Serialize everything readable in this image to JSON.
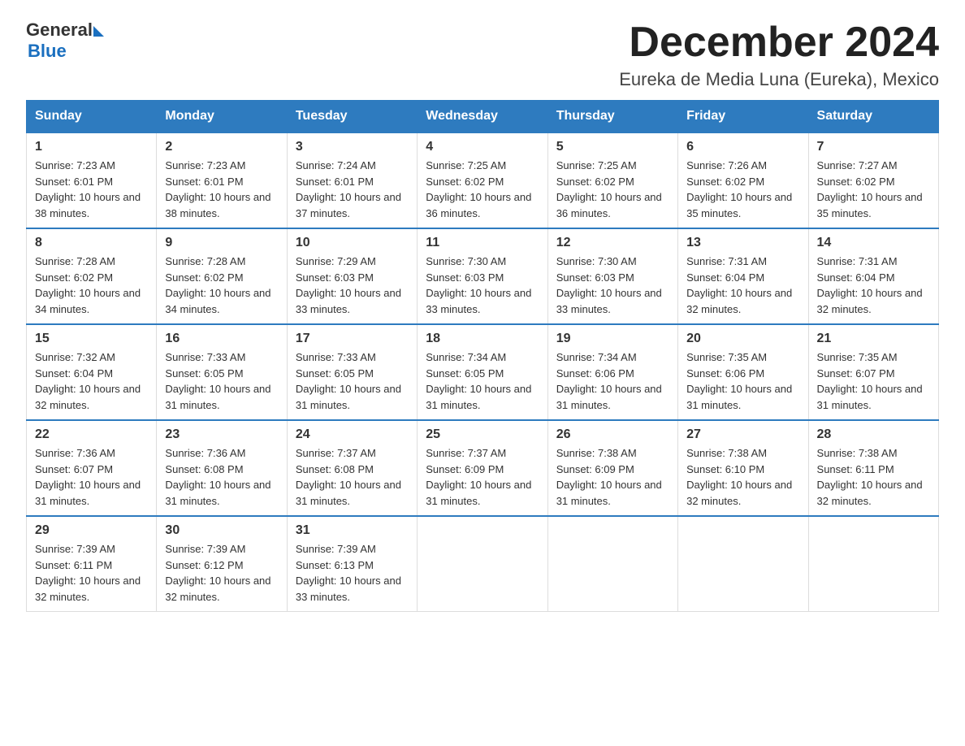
{
  "header": {
    "logo_general": "General",
    "logo_blue": "Blue",
    "title": "December 2024",
    "subtitle": "Eureka de Media Luna (Eureka), Mexico"
  },
  "days_of_week": [
    "Sunday",
    "Monday",
    "Tuesday",
    "Wednesday",
    "Thursday",
    "Friday",
    "Saturday"
  ],
  "weeks": [
    [
      {
        "day": "1",
        "sunrise": "7:23 AM",
        "sunset": "6:01 PM",
        "daylight": "10 hours and 38 minutes."
      },
      {
        "day": "2",
        "sunrise": "7:23 AM",
        "sunset": "6:01 PM",
        "daylight": "10 hours and 38 minutes."
      },
      {
        "day": "3",
        "sunrise": "7:24 AM",
        "sunset": "6:01 PM",
        "daylight": "10 hours and 37 minutes."
      },
      {
        "day": "4",
        "sunrise": "7:25 AM",
        "sunset": "6:02 PM",
        "daylight": "10 hours and 36 minutes."
      },
      {
        "day": "5",
        "sunrise": "7:25 AM",
        "sunset": "6:02 PM",
        "daylight": "10 hours and 36 minutes."
      },
      {
        "day": "6",
        "sunrise": "7:26 AM",
        "sunset": "6:02 PM",
        "daylight": "10 hours and 35 minutes."
      },
      {
        "day": "7",
        "sunrise": "7:27 AM",
        "sunset": "6:02 PM",
        "daylight": "10 hours and 35 minutes."
      }
    ],
    [
      {
        "day": "8",
        "sunrise": "7:28 AM",
        "sunset": "6:02 PM",
        "daylight": "10 hours and 34 minutes."
      },
      {
        "day": "9",
        "sunrise": "7:28 AM",
        "sunset": "6:02 PM",
        "daylight": "10 hours and 34 minutes."
      },
      {
        "day": "10",
        "sunrise": "7:29 AM",
        "sunset": "6:03 PM",
        "daylight": "10 hours and 33 minutes."
      },
      {
        "day": "11",
        "sunrise": "7:30 AM",
        "sunset": "6:03 PM",
        "daylight": "10 hours and 33 minutes."
      },
      {
        "day": "12",
        "sunrise": "7:30 AM",
        "sunset": "6:03 PM",
        "daylight": "10 hours and 33 minutes."
      },
      {
        "day": "13",
        "sunrise": "7:31 AM",
        "sunset": "6:04 PM",
        "daylight": "10 hours and 32 minutes."
      },
      {
        "day": "14",
        "sunrise": "7:31 AM",
        "sunset": "6:04 PM",
        "daylight": "10 hours and 32 minutes."
      }
    ],
    [
      {
        "day": "15",
        "sunrise": "7:32 AM",
        "sunset": "6:04 PM",
        "daylight": "10 hours and 32 minutes."
      },
      {
        "day": "16",
        "sunrise": "7:33 AM",
        "sunset": "6:05 PM",
        "daylight": "10 hours and 31 minutes."
      },
      {
        "day": "17",
        "sunrise": "7:33 AM",
        "sunset": "6:05 PM",
        "daylight": "10 hours and 31 minutes."
      },
      {
        "day": "18",
        "sunrise": "7:34 AM",
        "sunset": "6:05 PM",
        "daylight": "10 hours and 31 minutes."
      },
      {
        "day": "19",
        "sunrise": "7:34 AM",
        "sunset": "6:06 PM",
        "daylight": "10 hours and 31 minutes."
      },
      {
        "day": "20",
        "sunrise": "7:35 AM",
        "sunset": "6:06 PM",
        "daylight": "10 hours and 31 minutes."
      },
      {
        "day": "21",
        "sunrise": "7:35 AM",
        "sunset": "6:07 PM",
        "daylight": "10 hours and 31 minutes."
      }
    ],
    [
      {
        "day": "22",
        "sunrise": "7:36 AM",
        "sunset": "6:07 PM",
        "daylight": "10 hours and 31 minutes."
      },
      {
        "day": "23",
        "sunrise": "7:36 AM",
        "sunset": "6:08 PM",
        "daylight": "10 hours and 31 minutes."
      },
      {
        "day": "24",
        "sunrise": "7:37 AM",
        "sunset": "6:08 PM",
        "daylight": "10 hours and 31 minutes."
      },
      {
        "day": "25",
        "sunrise": "7:37 AM",
        "sunset": "6:09 PM",
        "daylight": "10 hours and 31 minutes."
      },
      {
        "day": "26",
        "sunrise": "7:38 AM",
        "sunset": "6:09 PM",
        "daylight": "10 hours and 31 minutes."
      },
      {
        "day": "27",
        "sunrise": "7:38 AM",
        "sunset": "6:10 PM",
        "daylight": "10 hours and 32 minutes."
      },
      {
        "day": "28",
        "sunrise": "7:38 AM",
        "sunset": "6:11 PM",
        "daylight": "10 hours and 32 minutes."
      }
    ],
    [
      {
        "day": "29",
        "sunrise": "7:39 AM",
        "sunset": "6:11 PM",
        "daylight": "10 hours and 32 minutes."
      },
      {
        "day": "30",
        "sunrise": "7:39 AM",
        "sunset": "6:12 PM",
        "daylight": "10 hours and 32 minutes."
      },
      {
        "day": "31",
        "sunrise": "7:39 AM",
        "sunset": "6:13 PM",
        "daylight": "10 hours and 33 minutes."
      },
      null,
      null,
      null,
      null
    ]
  ],
  "labels": {
    "sunrise_prefix": "Sunrise: ",
    "sunset_prefix": "Sunset: ",
    "daylight_prefix": "Daylight: "
  }
}
